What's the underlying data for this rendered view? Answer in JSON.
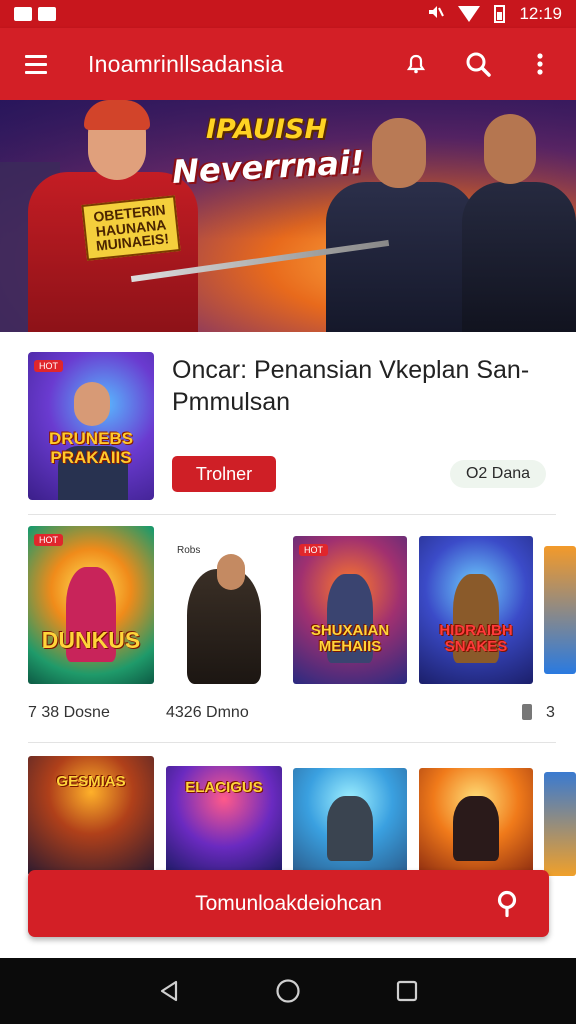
{
  "status_bar": {
    "time": "12:19"
  },
  "app_bar": {
    "title": "Inoamrinllsadansia"
  },
  "hero": {
    "title": "IPAUISH",
    "subtitle": "Neverrnai!",
    "sign_text": "OBETERIN HAUNANA MUINAEIS!"
  },
  "featured": {
    "title": "Oncar: Penansian Vkeplan San-Pmmulsan",
    "badge": "HOT",
    "thumb_text": "DRUNEBS PRAKAIIS",
    "button_label": "Trolner",
    "tag_label": "O2 Dana"
  },
  "row1": {
    "cards": [
      {
        "badge": "HOT",
        "text": "DUNKUS",
        "style": "big"
      },
      {
        "badge": "Robs",
        "text": ""
      },
      {
        "badge": "HOT",
        "text": "SHUXAIAN MEHAIIS"
      },
      {
        "badge": "",
        "text": "HIDRAIBH SNAKES"
      }
    ],
    "meta_left": "7 38 Dosne",
    "meta_mid": "4326 Dmno",
    "meta_right": "3"
  },
  "row2": {
    "cards": [
      {
        "text": "GESMIAS"
      },
      {
        "text": "ELACIGUS"
      },
      {
        "text": ""
      },
      {
        "text": ""
      }
    ]
  },
  "download_bar": {
    "label": "Tomunloakdeiohcan"
  },
  "colors": {
    "primary": "#d31f26",
    "status": "#c8161d"
  }
}
